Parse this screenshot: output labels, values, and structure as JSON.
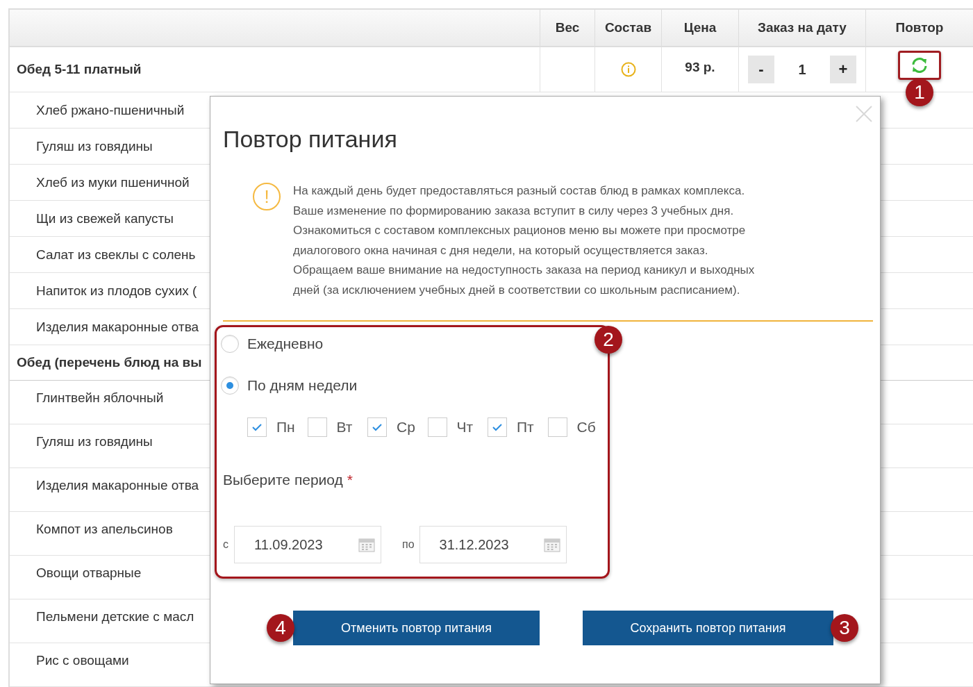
{
  "table": {
    "columns": [
      "Вес",
      "Состав",
      "Цена",
      "Заказ на дату",
      "Повтор"
    ],
    "rows": [
      {
        "kind": "complex",
        "name": "Обед 5-11 платный",
        "price": "93 р.",
        "minus": "-",
        "quantity": "1",
        "plus": "+",
        "repeat_highlighted": true,
        "repeat_badge": "1"
      },
      {
        "kind": "dish",
        "name": "Хлеб ржано-пшеничный"
      },
      {
        "kind": "dish",
        "name": "Гуляш из говядины"
      },
      {
        "kind": "dish",
        "name": "Хлеб из муки пшеничной"
      },
      {
        "kind": "dish",
        "name": "Щи из свежей капусты"
      },
      {
        "kind": "dish",
        "name": "Салат из свеклы с солень"
      },
      {
        "kind": "dish",
        "name": "Напиток из плодов сухих ("
      },
      {
        "kind": "dish",
        "name": "Изделия макаронные отва"
      },
      {
        "kind": "group",
        "name": "Обед (перечень блюд на вы"
      },
      {
        "kind": "dish2",
        "name": "Глинтвейн яблочный"
      },
      {
        "kind": "dish2",
        "name": "Гуляш из говядины"
      },
      {
        "kind": "dish2",
        "name": "Изделия макаронные отва"
      },
      {
        "kind": "dish2",
        "name": "Компот из апельсинов"
      },
      {
        "kind": "dish2",
        "name": "Овощи отварные"
      },
      {
        "kind": "dish2",
        "name": "Пельмени детские с масл"
      },
      {
        "kind": "dish2",
        "name": "Рис с овощами"
      }
    ]
  },
  "dialog": {
    "title": "Повтор питания",
    "notice": "На каждый день будет предоставляться разный состав блюд в рамках комплекса.\nВаше изменение по формированию заказа вступит в силу через 3 учебных дня.\nОзнакомиться с составом комплексных рационов меню вы можете при просмотре\nдиалогового окна начиная с дня недели, на который осуществляется заказ.\nОбращаем ваше внимание на недоступность заказа на период каникул и выходных\nдней (за исключением учебных дней в соответствии со школьным расписанием).",
    "notice_icon": "!",
    "options_badge": "2",
    "modes": [
      {
        "label": "Ежедневно",
        "selected": false
      },
      {
        "label": "По дням недели",
        "selected": true
      }
    ],
    "days": [
      {
        "label": "Пн",
        "checked": true
      },
      {
        "label": "Вт",
        "checked": false
      },
      {
        "label": "Ср",
        "checked": true
      },
      {
        "label": "Чт",
        "checked": false
      },
      {
        "label": "Пт",
        "checked": true
      },
      {
        "label": "Сб",
        "checked": false
      }
    ],
    "period_label": "Выберите период",
    "required_mark": "*",
    "from_label": "с",
    "from_value": "11.09.2023",
    "to_label": "по",
    "to_value": "31.12.2023",
    "cancel_button": "Отменить повтор питания",
    "cancel_badge": "4",
    "save_button": "Сохранить повтор питания",
    "save_badge": "3"
  }
}
